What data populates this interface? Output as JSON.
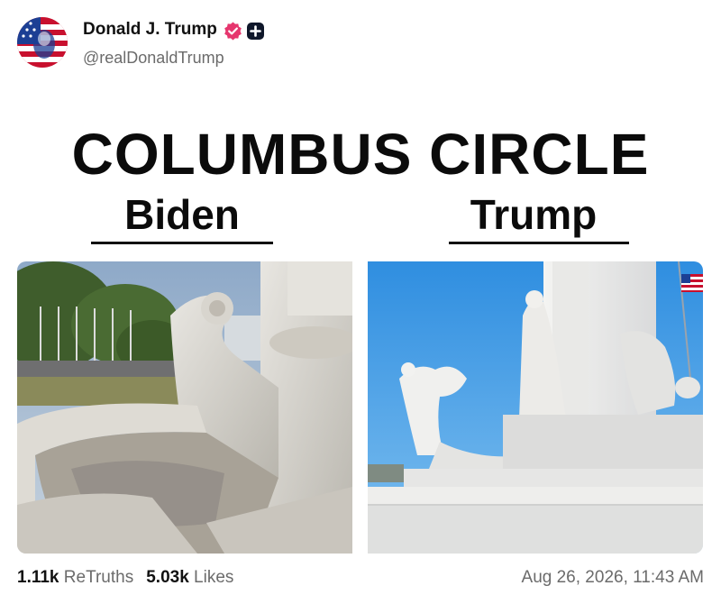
{
  "post": {
    "author_name": "Donald J. Trump",
    "handle": "@realDonaldTrump",
    "verified_icon": "verified-badge-icon",
    "plus_icon": "plus-badge-icon",
    "headline": "COLUMBUS CIRCLE",
    "left_label": "Biden",
    "right_label": "Trump",
    "retruths_count": "1.11k",
    "retruths_label": "ReTruths",
    "likes_count": "5.03k",
    "likes_label": "Likes",
    "timestamp": "Aug 26, 2026, 11:43 AM"
  },
  "colors": {
    "verified_badge": "#e6366e",
    "text_secondary": "#6b6b6b"
  }
}
